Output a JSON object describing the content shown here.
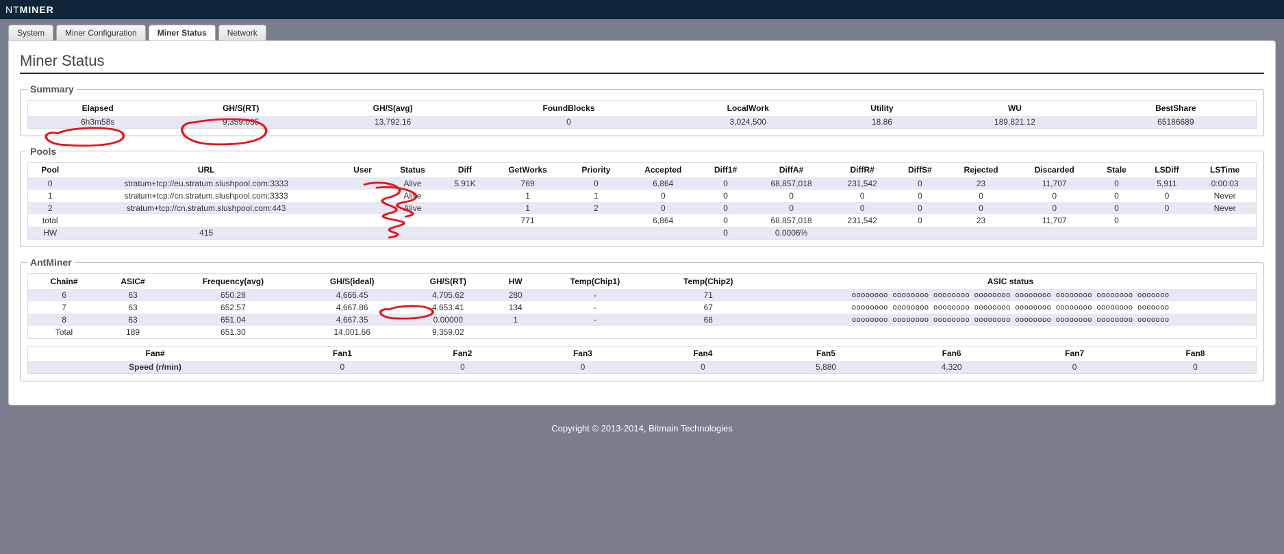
{
  "app": {
    "brand_light": "NT",
    "brand_bold": "MINER"
  },
  "tabs": {
    "system": "System",
    "minerconf": "Miner Configuration",
    "status": "Miner Status",
    "network": "Network",
    "active": "status"
  },
  "page_title": "Miner Status",
  "summary": {
    "legend": "Summary",
    "headers": {
      "elapsed": "Elapsed",
      "ghsrt": "GH/S(RT)",
      "ghsavg": "GH/S(avg)",
      "found": "FoundBlocks",
      "local": "LocalWork",
      "utility": "Utility",
      "wu": "WU",
      "best": "BestShare"
    },
    "row": {
      "elapsed": "6h3m58s",
      "ghsrt": "9,359.035",
      "ghsavg": "13,792.16",
      "found": "0",
      "local": "3,024,500",
      "utility": "18.86",
      "wu": "189,821.12",
      "best": "65186689"
    }
  },
  "pools": {
    "legend": "Pools",
    "headers": {
      "pool": "Pool",
      "url": "URL",
      "user": "User",
      "status": "Status",
      "diff": "Diff",
      "getworks": "GetWorks",
      "priority": "Priority",
      "accepted": "Accepted",
      "diff1": "Diff1#",
      "diffa": "DiffA#",
      "diffr": "DiffR#",
      "diffs": "DiffS#",
      "rejected": "Rejected",
      "discarded": "Discarded",
      "stale": "Stale",
      "lsdiff": "LSDiff",
      "lstime": "LSTime"
    },
    "rows": [
      {
        "pool": "0",
        "url": "stratum+tcp://eu.stratum.slushpool.com:3333",
        "user": "",
        "status": "Alive",
        "diff": "5.91K",
        "getworks": "769",
        "priority": "0",
        "accepted": "6,864",
        "diff1": "0",
        "diffa": "68,857,018",
        "diffr": "231,542",
        "diffs": "0",
        "rejected": "23",
        "discarded": "11,707",
        "stale": "0",
        "lsdiff": "5,911",
        "lstime": "0:00:03"
      },
      {
        "pool": "1",
        "url": "stratum+tcp://cn.stratum.slushpool.com:3333",
        "user": "",
        "status": "Alive",
        "diff": "",
        "getworks": "1",
        "priority": "1",
        "accepted": "0",
        "diff1": "0",
        "diffa": "0",
        "diffr": "0",
        "diffs": "0",
        "rejected": "0",
        "discarded": "0",
        "stale": "0",
        "lsdiff": "0",
        "lstime": "Never"
      },
      {
        "pool": "2",
        "url": "stratum+tcp://cn.stratum.slushpool.com:443",
        "user": "",
        "status": "Alive",
        "diff": "",
        "getworks": "1",
        "priority": "2",
        "accepted": "0",
        "diff1": "0",
        "diffa": "0",
        "diffr": "0",
        "diffs": "0",
        "rejected": "0",
        "discarded": "0",
        "stale": "0",
        "lsdiff": "0",
        "lstime": "Never"
      }
    ],
    "total": {
      "label": "total",
      "url": "",
      "user": "",
      "status": "",
      "diff": "",
      "getworks": "771",
      "priority": "",
      "accepted": "6,864",
      "diff1": "0",
      "diffa": "68,857,018",
      "diffr": "231,542",
      "diffs": "0",
      "rejected": "23",
      "discarded": "11,707",
      "stale": "0",
      "lsdiff": "",
      "lstime": ""
    },
    "hw": {
      "label": "HW",
      "url": "415",
      "diff1": "0",
      "diffa": "0.0006%"
    }
  },
  "antminer": {
    "legend": "AntMiner",
    "headers": {
      "chain": "Chain#",
      "asic": "ASIC#",
      "freq": "Frequency(avg)",
      "ghsi": "GH/S(ideal)",
      "ghsrt": "GH/S(RT)",
      "hw": "HW",
      "t1": "Temp(Chip1)",
      "t2": "Temp(Chip2)",
      "astat": "ASIC status"
    },
    "rows": [
      {
        "chain": "6",
        "asic": "63",
        "freq": "650.28",
        "ghsi": "4,666.45",
        "ghsrt": "4,705.62",
        "hw": "280",
        "t1": "-",
        "t2": "71",
        "astat": "oooooooo oooooooo oooooooo oooooooo oooooooo oooooooo oooooooo ooooooo"
      },
      {
        "chain": "7",
        "asic": "63",
        "freq": "652.57",
        "ghsi": "4,667.86",
        "ghsrt": "4,653.41",
        "hw": "134",
        "t1": "-",
        "t2": "67",
        "astat": "oooooooo oooooooo oooooooo oooooooo oooooooo oooooooo oooooooo ooooooo"
      },
      {
        "chain": "8",
        "asic": "63",
        "freq": "651.04",
        "ghsi": "4,667.35",
        "ghsrt": "0.00000",
        "hw": "1",
        "t1": "-",
        "t2": "68",
        "astat": "oooooooo oooooooo oooooooo oooooooo oooooooo oooooooo oooooooo ooooooo"
      }
    ],
    "total": {
      "label": "Total",
      "asic": "189",
      "freq": "651.30",
      "ghsi": "14,001.66",
      "ghsrt": "9,359.02"
    },
    "fan_headers": {
      "fan": "Fan#",
      "f1": "Fan1",
      "f2": "Fan2",
      "f3": "Fan3",
      "f4": "Fan4",
      "f5": "Fan5",
      "f6": "Fan6",
      "f7": "Fan7",
      "f8": "Fan8"
    },
    "fan_row": {
      "label": "Speed (r/min)",
      "f1": "0",
      "f2": "0",
      "f3": "0",
      "f4": "0",
      "f5": "5,880",
      "f6": "4,320",
      "f7": "0",
      "f8": "0"
    }
  },
  "footer": "Copyright © 2013-2014, Bitmain Technologies"
}
